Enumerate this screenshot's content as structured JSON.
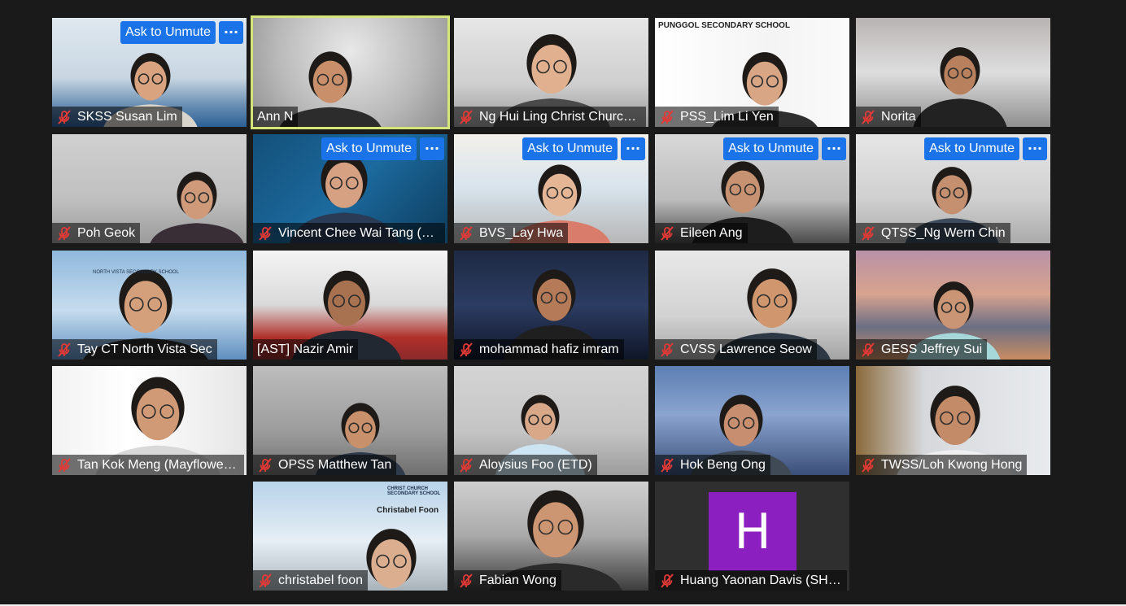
{
  "meeting": {
    "ask_to_unmute_label": "Ask to Unmute",
    "more_label": "···",
    "active_speaker_color": "#d6e57a",
    "button_color": "#1a73e8"
  },
  "participants": [
    {
      "name": "SKSS Susan Lim",
      "ask_to_unmute": true,
      "muted": true
    },
    {
      "name": "Ann N",
      "active_speaker": true,
      "muted": false
    },
    {
      "name": "Ng Hui Ling Christ Church Secondary School",
      "muted": true
    },
    {
      "name": "PSS_Lim Li Yen",
      "muted": true,
      "background_text": "PUNGGOL SECONDARY SCHOOL"
    },
    {
      "name": "Norita",
      "muted": true
    },
    {
      "name": "Poh Geok",
      "muted": true
    },
    {
      "name": "Vincent Chee Wai Tang (NCHS)",
      "ask_to_unmute": true,
      "muted": true
    },
    {
      "name": "BVS_Lay Hwa",
      "ask_to_unmute": true,
      "muted": true
    },
    {
      "name": "Eileen Ang",
      "ask_to_unmute": true,
      "muted": true
    },
    {
      "name": "QTSS_Ng Wern Chin",
      "ask_to_unmute": true,
      "muted": true
    },
    {
      "name": "Tay CT North Vista Sec",
      "muted": true,
      "background_text": "NORTH VISTA SECONDARY SCHOOL"
    },
    {
      "name": "[AST] Nazir Amir",
      "muted": false
    },
    {
      "name": "mohammad hafiz imram",
      "muted": true
    },
    {
      "name": "CVSS Lawrence Seow",
      "muted": true
    },
    {
      "name": "GESS Jeffrey Sui",
      "muted": true
    },
    {
      "name": "Tan Kok Meng (Mayflower Secondary School)",
      "muted": true
    },
    {
      "name": "OPSS Matthew Tan",
      "muted": true
    },
    {
      "name": "Aloysius Foo (ETD)",
      "muted": true
    },
    {
      "name": "Hok Beng Ong",
      "muted": true
    },
    {
      "name": "TWSS/Loh Kwong Hong",
      "muted": true
    },
    {
      "name": "christabel foon",
      "muted": true,
      "background_text": "Christabel Foon",
      "background_text_2": "CHRIST CHURCH SECONDARY SCHOOL"
    },
    {
      "name": "Fabian Wong",
      "muted": true
    },
    {
      "name": "Huang Yaonan Davis (SH Secondary School)",
      "muted": true,
      "avatar_letter": "H",
      "avatar_color": "#8b1fc0"
    }
  ]
}
